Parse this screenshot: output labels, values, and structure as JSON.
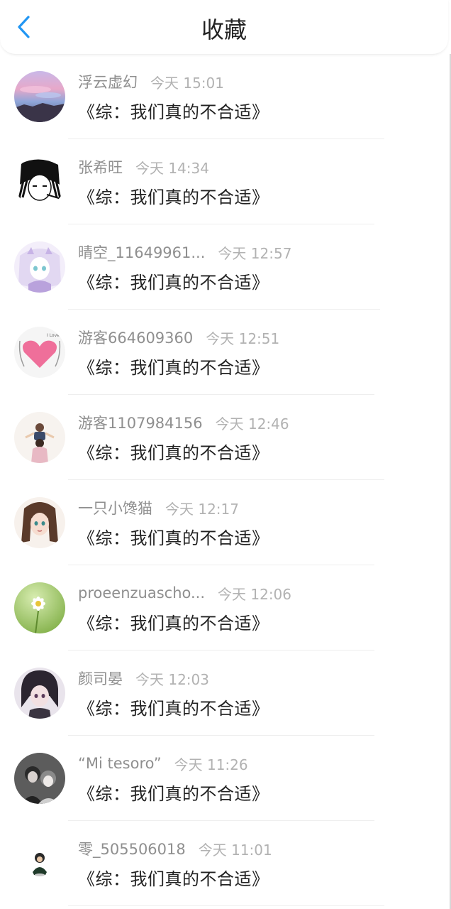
{
  "header": {
    "title": "收藏",
    "back_icon": "chevron-left-icon",
    "accent_color": "#2196F3"
  },
  "items": [
    {
      "name": "浮云虚幻",
      "time": "今天 15:01",
      "book": "《综：我们真的不合适》",
      "avatar": "sunset-sky"
    },
    {
      "name": "张希旺",
      "time": "今天 14:34",
      "book": "《综：我们真的不合适》",
      "avatar": "manga-sketch"
    },
    {
      "name": "晴空_11649961...",
      "time": "今天 12:57",
      "book": "《综：我们真的不合适》",
      "avatar": "anime-girl-lilac"
    },
    {
      "name": "游客664609360",
      "time": "今天 12:51",
      "book": "《综：我们真的不合适》",
      "avatar": "pink-heart"
    },
    {
      "name": "游客1107984156",
      "time": "今天 12:46",
      "book": "《综：我们真的不合适》",
      "avatar": "parent-child-photo"
    },
    {
      "name": "一只小馋猫",
      "time": "今天 12:17",
      "book": "《综：我们真的不合适》",
      "avatar": "anime-girl-brown-hair"
    },
    {
      "name": "proeenzuascho...",
      "time": "今天 12:06",
      "book": "《综：我们真的不合适》",
      "avatar": "daisy-flower"
    },
    {
      "name": "颜司晏",
      "time": "今天 12:03",
      "book": "《综：我们真的不合适》",
      "avatar": "anime-boy-dark"
    },
    {
      "name": "“Mi tesoro”",
      "time": "今天 11:26",
      "book": "《综：我们真的不合适》",
      "avatar": "anime-couple"
    },
    {
      "name": "零_505506018",
      "time": "今天 11:01",
      "book": "《综：我们真的不合适》",
      "avatar": "small-figure"
    }
  ]
}
